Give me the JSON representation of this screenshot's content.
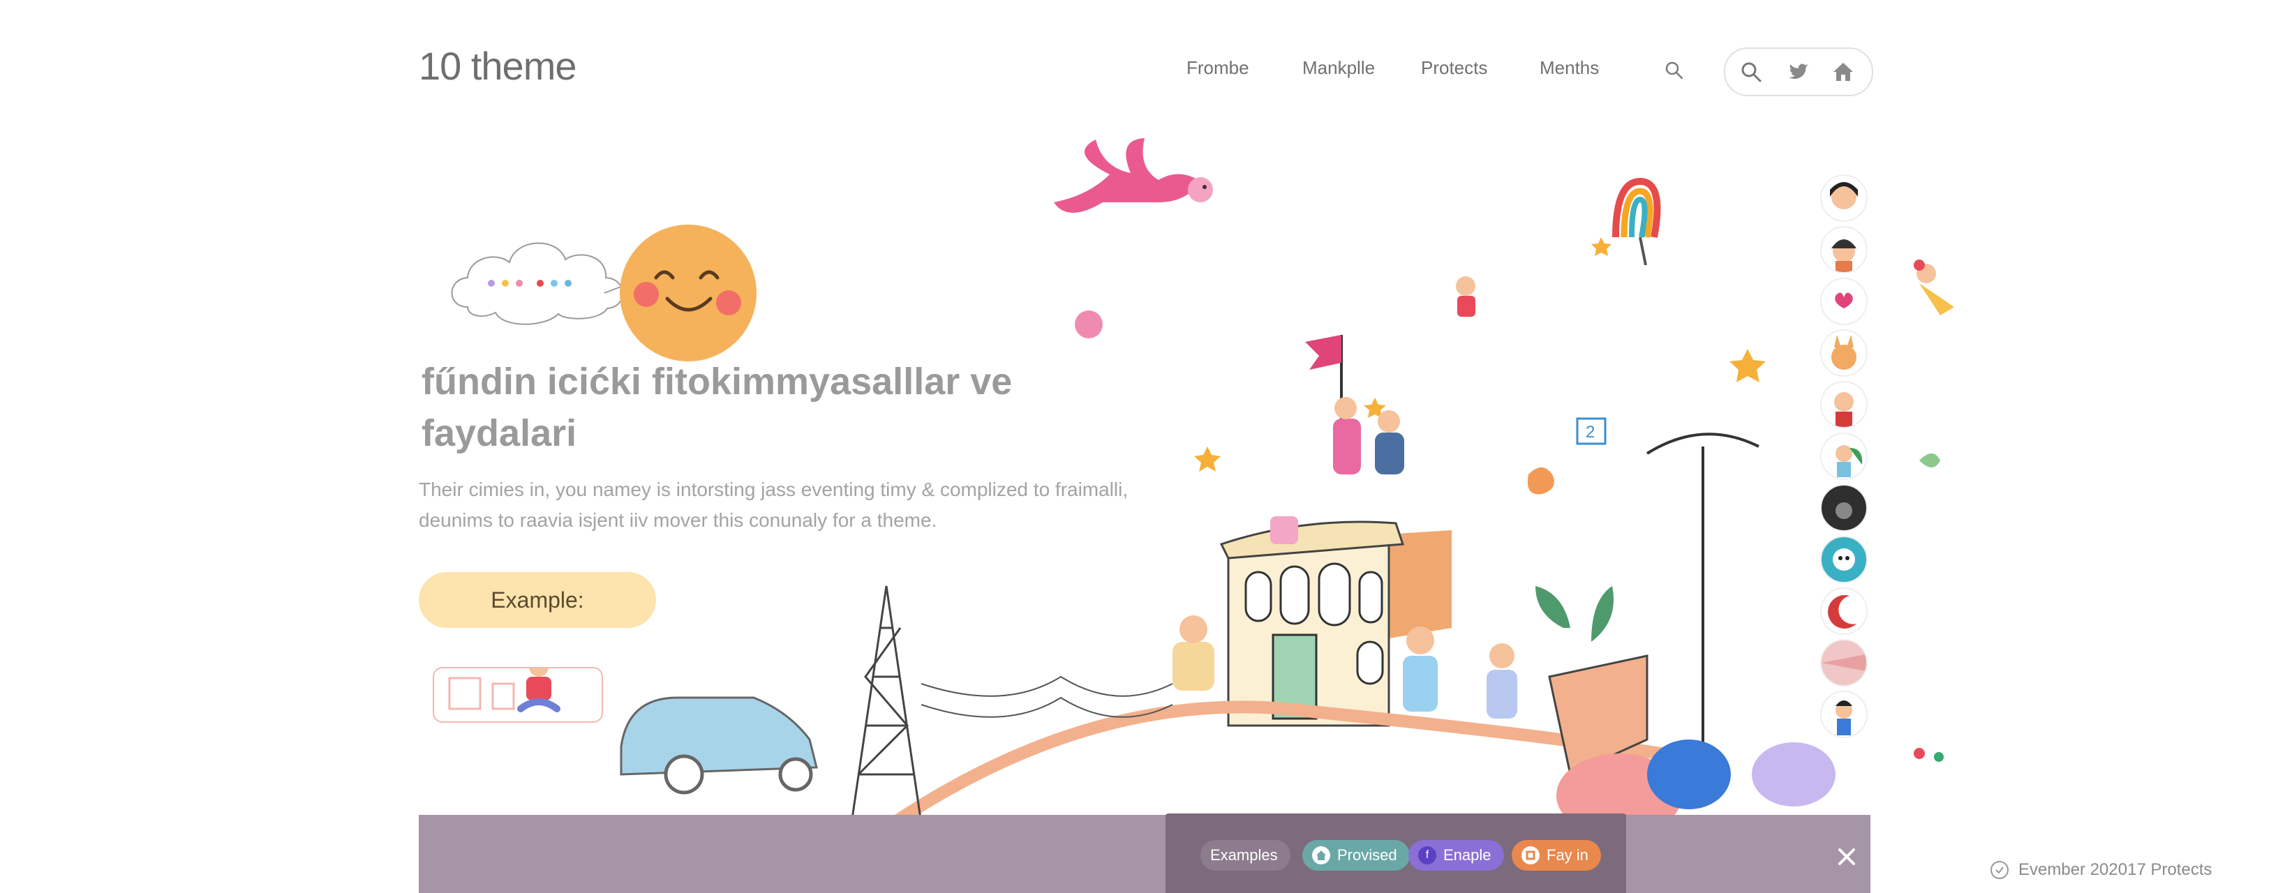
{
  "header": {
    "logo": "10 theme",
    "nav": [
      "Frombe",
      "Mankplle",
      "Protects",
      "Menths"
    ]
  },
  "hero": {
    "headline": "fűndin icićki fitokimmyasalllar ve faydalari",
    "body": "Their cimies in, you namey is intorsting jass eventing timy & complized to fraimalli, deunims to raavia isjent iiv mover this conunaly for a theme.",
    "cta_label": "Example:"
  },
  "illustration": {
    "flag_number": "2"
  },
  "bottom_panel": {
    "chips": [
      {
        "label": "Examples",
        "icon": "none-icon",
        "color": "#8c7c8d"
      },
      {
        "label": "Provised",
        "icon": "home-icon",
        "color": "#6aa8a8"
      },
      {
        "label": "Enaple",
        "icon": "facebook-icon",
        "color": "#8a6fd6"
      },
      {
        "label": "Fay in",
        "icon": "square-icon",
        "color": "#e8884c"
      }
    ]
  },
  "footer": {
    "note": "Evember 202017 Protects"
  },
  "colors": {
    "accent_yellow": "#fde3ae",
    "bottom_bar": "#a695a6",
    "panel": "#7b6b7c"
  }
}
